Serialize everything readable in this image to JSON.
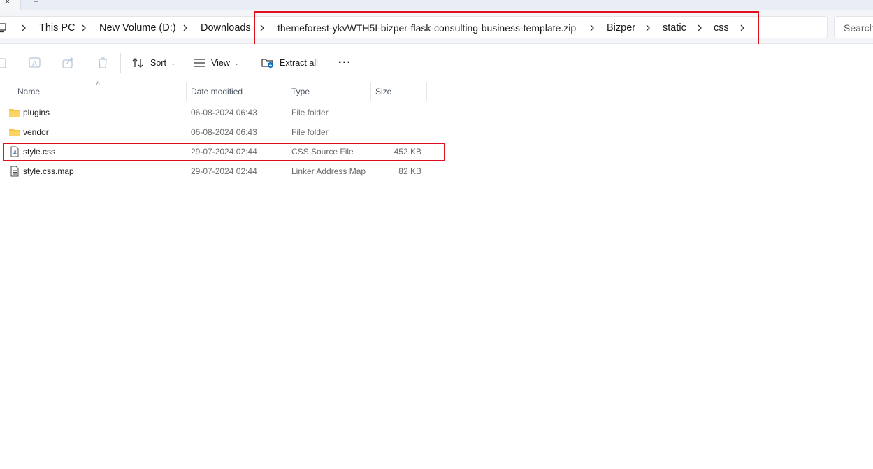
{
  "breadcrumb": {
    "items": [
      {
        "label": "This PC"
      },
      {
        "label": "New Volume (D:)"
      },
      {
        "label": "Downloads"
      },
      {
        "label": "themeforest-ykvWTH5I-bizper-flask-consulting-business-template.zip"
      },
      {
        "label": "Bizper"
      },
      {
        "label": "static"
      },
      {
        "label": "css"
      }
    ]
  },
  "search": {
    "placeholder": "Search"
  },
  "toolbar": {
    "sort_label": "Sort",
    "view_label": "View",
    "extract_label": "Extract all",
    "more_label": "···"
  },
  "columns": {
    "name": "Name",
    "date": "Date modified",
    "type": "Type",
    "size": "Size"
  },
  "files": [
    {
      "name": "plugins",
      "date": "06-08-2024 06:43",
      "type": "File folder",
      "size": "",
      "icon": "folder-icon"
    },
    {
      "name": "vendor",
      "date": "06-08-2024 06:43",
      "type": "File folder",
      "size": "",
      "icon": "folder-icon"
    },
    {
      "name": "style.css",
      "date": "29-07-2024 02:44",
      "type": "CSS Source File",
      "size": "452 KB",
      "icon": "css-file-icon"
    },
    {
      "name": "style.css.map",
      "date": "29-07-2024 02:44",
      "type": "Linker Address Map",
      "size": "82 KB",
      "icon": "document-icon"
    }
  ],
  "colors": {
    "highlight": "#e0101f",
    "folder": "#f8c448",
    "accent": "#0067c0"
  }
}
